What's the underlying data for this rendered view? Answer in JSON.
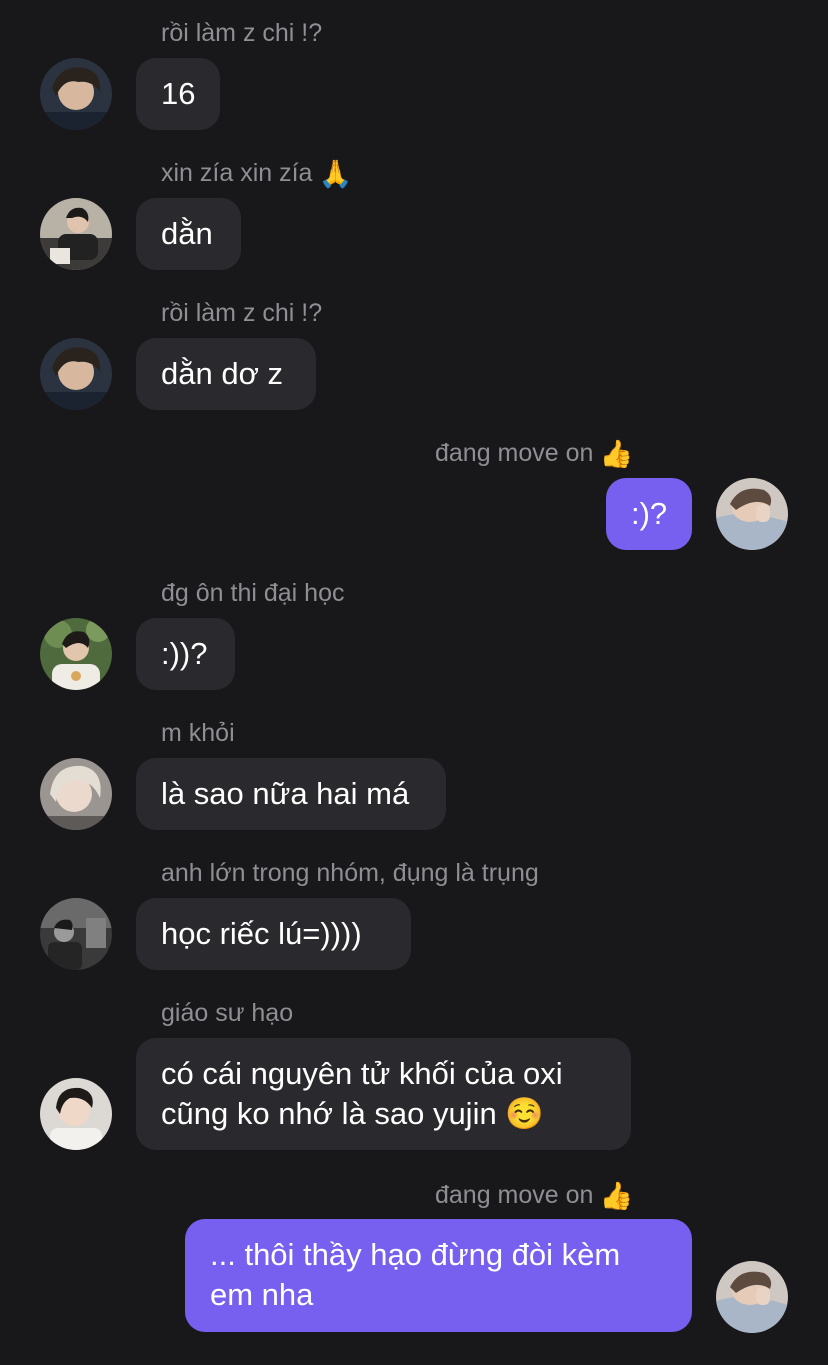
{
  "colors": {
    "background": "#18181b",
    "incoming_bubble": "#2a2a2e",
    "outgoing_bubble": "#7760ef",
    "sender_name": "#8e8e93",
    "text": "#ffffff"
  },
  "messages": [
    {
      "direction": "incoming",
      "sender": "rồi làm z chi !?",
      "text": "16",
      "avatar_icon": "user-avatar-a"
    },
    {
      "direction": "incoming",
      "sender": "xin zía xin zía",
      "sender_emoji": "🙏",
      "text": "dằn",
      "avatar_icon": "user-avatar-b"
    },
    {
      "direction": "incoming",
      "sender": "rồi làm z chi !?",
      "text": "dằn dơ z",
      "avatar_icon": "user-avatar-a"
    },
    {
      "direction": "outgoing",
      "sender": "đang move on",
      "sender_emoji": "👍",
      "text": ":)?",
      "avatar_icon": "self-avatar"
    },
    {
      "direction": "incoming",
      "sender": "đg ôn thi đại học",
      "text": ":))?",
      "avatar_icon": "user-avatar-c"
    },
    {
      "direction": "incoming",
      "sender": "m khỏi",
      "text": "là sao nữa hai má",
      "avatar_icon": "user-avatar-d"
    },
    {
      "direction": "incoming",
      "sender": "anh lớn trong nhóm, đụng là trụng",
      "text": "học riếc lú=))))",
      "avatar_icon": "user-avatar-e"
    },
    {
      "direction": "incoming",
      "sender": "giáo sư hạo",
      "text": "có cái nguyên tử khối của oxi\ncũng ko nhớ là sao yujin ☺️",
      "avatar_icon": "user-avatar-f"
    },
    {
      "direction": "outgoing",
      "sender": "đang move on",
      "sender_emoji": "👍",
      "text": "... thôi thầy hạo đừng đòi kèm\nem nha",
      "avatar_icon": "self-avatar"
    }
  ]
}
